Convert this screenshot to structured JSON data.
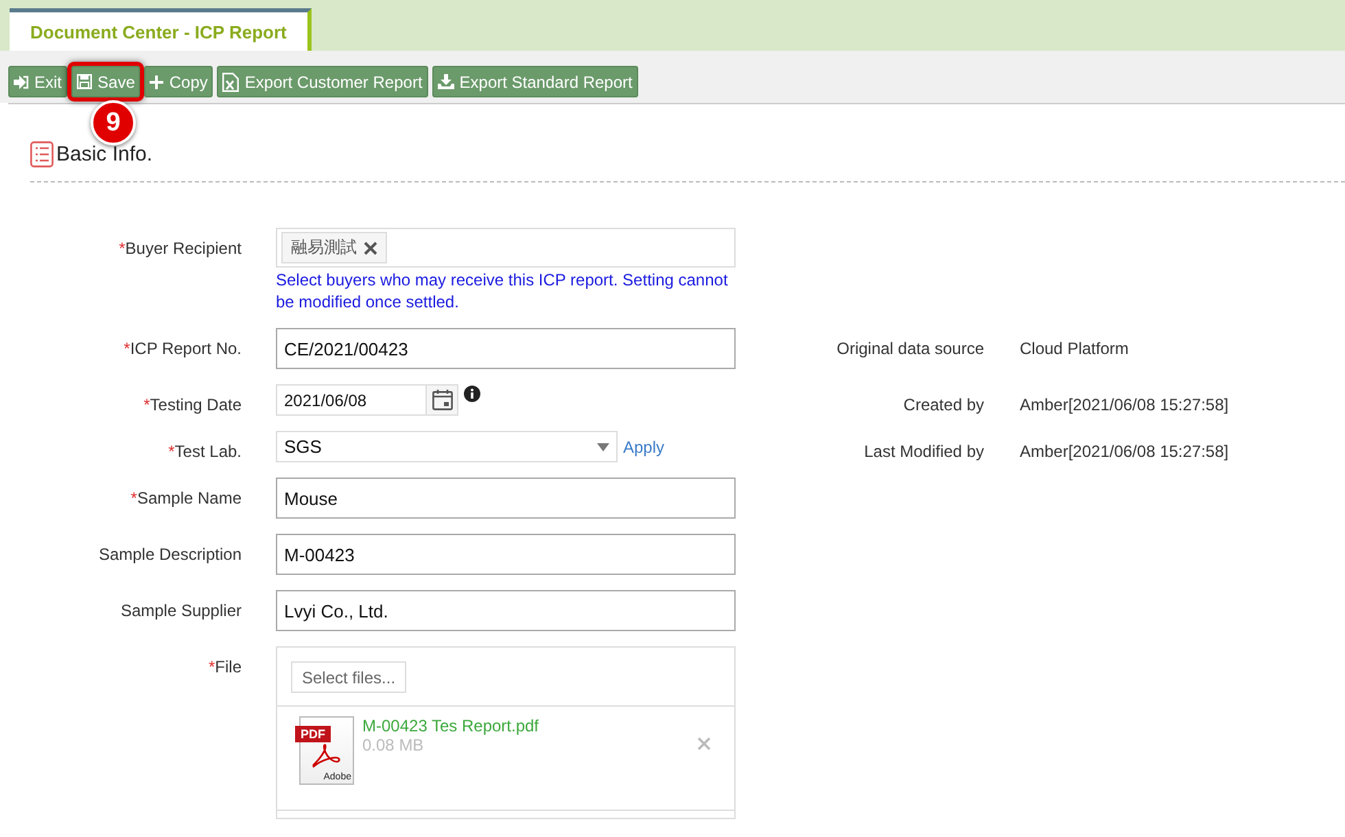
{
  "tabs": [
    {
      "label": "Document Center - ICP Report",
      "selected": true
    }
  ],
  "toolbar": [
    {
      "label": "Exit",
      "highlighted": false
    },
    {
      "label": "Save",
      "highlighted": true,
      "callout": "9"
    },
    {
      "label": "Copy",
      "highlighted": false
    },
    {
      "label": "Export Customer Report",
      "highlighted": false
    },
    {
      "label": "Export Standard Report",
      "highlighted": false
    }
  ],
  "section": {
    "title": "Basic Info."
  },
  "fields": [
    {
      "kind": "tags",
      "label": "Buyer Recipient",
      "mark": "*",
      "tags": [
        "融易測試"
      ],
      "hint": "Select buyers who may receive this ICP report. Setting cannot be modified once settled."
    },
    {
      "kind": "text",
      "label": "ICP Report No.",
      "mark": "*",
      "value": "CE/2021/00423"
    },
    {
      "kind": "date",
      "label": "Testing Date",
      "mark": "*",
      "value": "2021/06/08"
    },
    {
      "kind": "select",
      "label": "Test Lab.",
      "mark": "*",
      "value": "SGS",
      "link": "Apply"
    },
    {
      "kind": "text",
      "label": "Sample Name",
      "mark": "*",
      "value": "Mouse"
    },
    {
      "kind": "text",
      "label": "Sample Description",
      "value": "M-00423"
    },
    {
      "kind": "text",
      "label": "Sample Supplier",
      "value": "Lvyi Co., Ltd."
    },
    {
      "kind": "file",
      "label": "File",
      "mark": "*",
      "button": "Select files...",
      "files": [
        {
          "name": "M-00423 Tes Report.pdf",
          "size": "0.08 MB",
          "badge": "PDF",
          "maker": "Adobe"
        }
      ]
    }
  ],
  "meta": [
    {
      "label": "Original data source",
      "value": "Cloud Platform"
    },
    {
      "label": "Created by",
      "value": "Amber[2021/06/08 15:27:58]"
    },
    {
      "label": "Last Modified by",
      "value": "Amber[2021/06/08 15:27:58]"
    }
  ]
}
